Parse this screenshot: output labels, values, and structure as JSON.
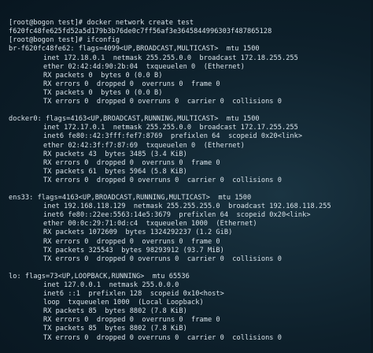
{
  "terminal": {
    "lines": [
      {
        "text": "[root@bogon test]# docker network create test",
        "indent": false
      },
      {
        "text": "f620fc48fe625fd52a5d179b3b76de0c7ff56af3e3645844996303f487865128",
        "indent": false
      },
      {
        "text": "[root@bogon test]# ifconfig",
        "indent": false
      },
      {
        "text": "br-f620fc48fe62: flags=4099<UP,BROADCAST,MULTICAST>  mtu 1500",
        "indent": false
      },
      {
        "text": "inet 172.18.0.1  netmask 255.255.0.0  broadcast 172.18.255.255",
        "indent": true
      },
      {
        "text": "ether 02:42:4d:90:2b:04  txqueuelen 0  (Ethernet)",
        "indent": true
      },
      {
        "text": "RX packets 0  bytes 0 (0.0 B)",
        "indent": true
      },
      {
        "text": "RX errors 0  dropped 0  overruns 0  frame 0",
        "indent": true
      },
      {
        "text": "TX packets 0  bytes 0 (0.0 B)",
        "indent": true
      },
      {
        "text": "TX errors 0  dropped 0 overruns 0  carrier 0  collisions 0",
        "indent": true
      },
      {
        "text": "",
        "indent": false
      },
      {
        "text": "docker0: flags=4163<UP,BROADCAST,RUNNING,MULTICAST>  mtu 1500",
        "indent": false
      },
      {
        "text": "inet 172.17.0.1  netmask 255.255.0.0  broadcast 172.17.255.255",
        "indent": true
      },
      {
        "text": "inet6 fe80::42:3fff:fef7:8769  prefixlen 64  scopeid 0x20<link>",
        "indent": true
      },
      {
        "text": "ether 02:42:3f:f7:87:69  txqueuelen 0  (Ethernet)",
        "indent": true
      },
      {
        "text": "RX packets 43  bytes 3485 (3.4 KiB)",
        "indent": true
      },
      {
        "text": "RX errors 0  dropped 0  overruns 0  frame 0",
        "indent": true
      },
      {
        "text": "TX packets 61  bytes 5964 (5.8 KiB)",
        "indent": true
      },
      {
        "text": "TX errors 0  dropped 0 overruns 0  carrier 0  collisions 0",
        "indent": true
      },
      {
        "text": "",
        "indent": false
      },
      {
        "text": "ens33: flags=4163<UP,BROADCAST,RUNNING,MULTICAST>  mtu 1500",
        "indent": false
      },
      {
        "text": "inet 192.168.118.129  netmask 255.255.255.0  broadcast 192.168.118.255",
        "indent": true
      },
      {
        "text": "inet6 fe80::22ee:5563:14e5:3679  prefixlen 64  scopeid 0x20<link>",
        "indent": true
      },
      {
        "text": "ether 00:0c:29:71:0d:c4  txqueuelen 1000  (Ethernet)",
        "indent": true
      },
      {
        "text": "RX packets 1072609  bytes 1324292237 (1.2 GiB)",
        "indent": true
      },
      {
        "text": "RX errors 0  dropped 0  overruns 0  frame 0",
        "indent": true
      },
      {
        "text": "TX packets 325543  bytes 98293912 (93.7 MiB)",
        "indent": true
      },
      {
        "text": "TX errors 0  dropped 0 overruns 0  carrier 0  collisions 0",
        "indent": true
      },
      {
        "text": "",
        "indent": false
      },
      {
        "text": "lo: flags=73<UP,LOOPBACK,RUNNING>  mtu 65536",
        "indent": false
      },
      {
        "text": "inet 127.0.0.1  netmask 255.0.0.0",
        "indent": true
      },
      {
        "text": "inet6 ::1  prefixlen 128  scopeid 0x10<host>",
        "indent": true
      },
      {
        "text": "loop  txqueuelen 1000  (Local Loopback)",
        "indent": true
      },
      {
        "text": "RX packets 85  bytes 8802 (7.8 KiB)",
        "indent": true
      },
      {
        "text": "RX errors 0  dropped 0  overruns 0  frame 0",
        "indent": true
      },
      {
        "text": "TX packets 85  bytes 8802 (7.8 KiB)",
        "indent": true
      },
      {
        "text": "TX errors 0  dropped 0 overruns 0  carrier 0  collisions 0",
        "indent": true
      }
    ]
  },
  "colors": {
    "background": "#0d1f2a",
    "text": "#d8e3ea"
  }
}
